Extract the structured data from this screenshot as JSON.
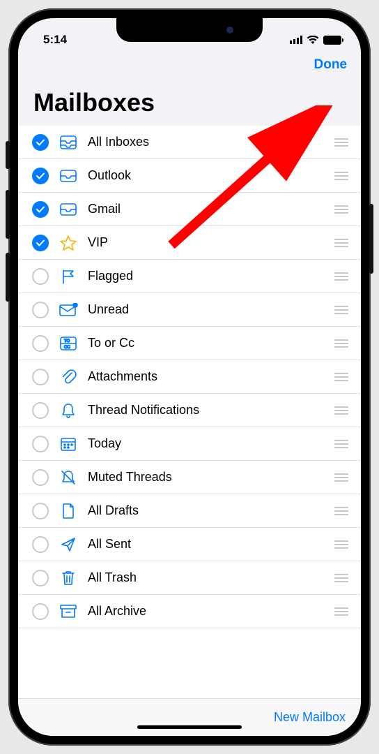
{
  "status": {
    "time": "5:14"
  },
  "nav": {
    "done_label": "Done"
  },
  "page": {
    "title": "Mailboxes"
  },
  "toolbar": {
    "new_mailbox_label": "New Mailbox"
  },
  "rows": [
    {
      "id": "all-inboxes",
      "label": "All Inboxes",
      "checked": true,
      "icon": "tray-stack"
    },
    {
      "id": "outlook",
      "label": "Outlook",
      "checked": true,
      "icon": "tray"
    },
    {
      "id": "gmail",
      "label": "Gmail",
      "checked": true,
      "icon": "tray"
    },
    {
      "id": "vip",
      "label": "VIP",
      "checked": true,
      "icon": "star"
    },
    {
      "id": "flagged",
      "label": "Flagged",
      "checked": false,
      "icon": "flag"
    },
    {
      "id": "unread",
      "label": "Unread",
      "checked": false,
      "icon": "envelope-badge"
    },
    {
      "id": "to-or-cc",
      "label": "To or Cc",
      "checked": false,
      "icon": "tocc"
    },
    {
      "id": "attachments",
      "label": "Attachments",
      "checked": false,
      "icon": "paperclip"
    },
    {
      "id": "thread-notifications",
      "label": "Thread Notifications",
      "checked": false,
      "icon": "bell"
    },
    {
      "id": "today",
      "label": "Today",
      "checked": false,
      "icon": "calendar"
    },
    {
      "id": "muted-threads",
      "label": "Muted Threads",
      "checked": false,
      "icon": "bell-slash"
    },
    {
      "id": "all-drafts",
      "label": "All Drafts",
      "checked": false,
      "icon": "doc"
    },
    {
      "id": "all-sent",
      "label": "All Sent",
      "checked": false,
      "icon": "paperplane"
    },
    {
      "id": "all-trash",
      "label": "All Trash",
      "checked": false,
      "icon": "trash"
    },
    {
      "id": "all-archive",
      "label": "All Archive",
      "checked": false,
      "icon": "archive"
    }
  ],
  "annotation": {
    "arrow_target": "done-button",
    "color": "#ff0000"
  }
}
